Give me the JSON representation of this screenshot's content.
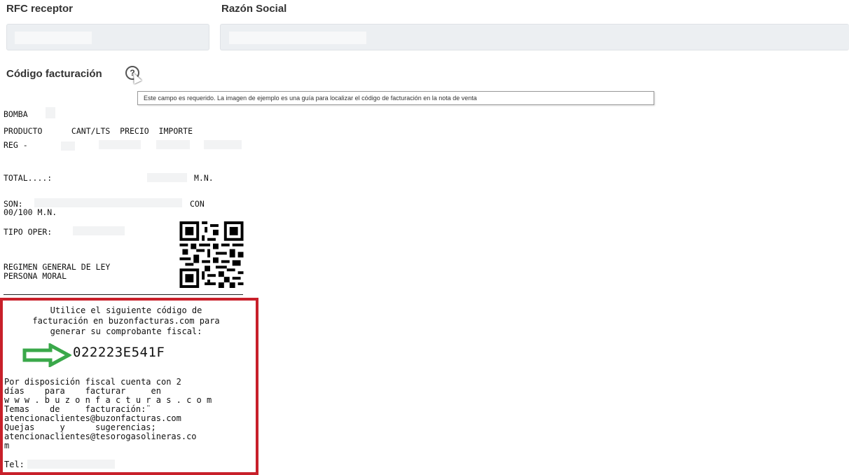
{
  "form": {
    "rfc_label": "RFC receptor",
    "razon_label": "Razón Social",
    "codigo_label": "Código facturación",
    "help_glyph": "?",
    "tooltip": "Este campo es requerido. La imagen de ejemplo es una guía para localizar el código de facturación en la nota de venta"
  },
  "receipt": {
    "bomba": "BOMBA",
    "header": "PRODUCTO      CANT/LTS  PRECIO  IMPORTE",
    "reg": "REG -",
    "total": "TOTAL....:",
    "total_unit": "M.N.",
    "son": "SON:",
    "con": "CON",
    "son_line2": "00/100 M.N.",
    "tipo_oper": "TIPO OPER:",
    "regimen_1": "REGIMEN GENERAL DE LEY",
    "regimen_2": "PERSONA MORAL"
  },
  "highlight": {
    "line_1": "Utilice el siguiente código de",
    "line_2": "facturación en buzonfacturas.com para",
    "line_3": "generar su comprobante fiscal:",
    "code": "022223E541F",
    "fine_1": "Por disposición fiscal cuenta con 2",
    "fine_2": "días    para    facturar     en",
    "fine_3": "w w w . b u z o n f a c t u r a s . c o m",
    "fine_4": "Temas    de     facturación:¨",
    "fine_5": "atencionaclientes@buzonfacturas.com",
    "fine_6": "Quejas     y      sugerencias;",
    "fine_7": "atencionaclientes@tesorogasolineras.co",
    "fine_8": "m",
    "fine_9": "Tel:"
  },
  "colors": {
    "highlight_border": "#c8202a",
    "arrow_green": "#3aa84a",
    "input_bg": "#eceff2"
  },
  "icons": [
    "help-circle-icon",
    "mouse-cursor-icon",
    "right-arrow-icon",
    "qr-code-icon"
  ]
}
